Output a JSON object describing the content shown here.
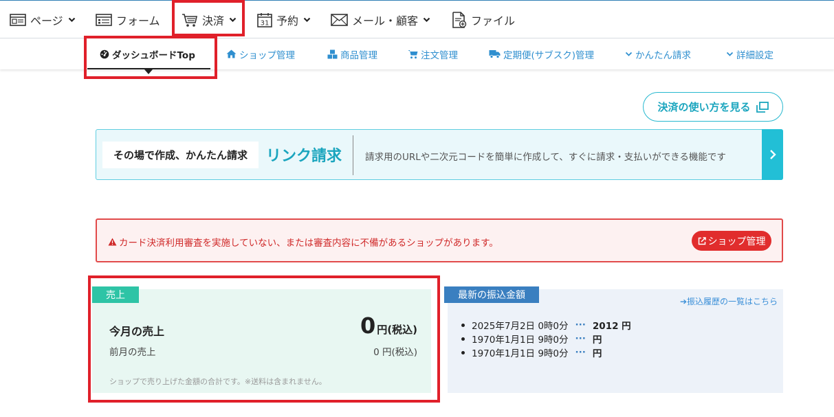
{
  "topnav": {
    "page": "ページ",
    "form": "フォーム",
    "payment": "決済",
    "reservation": "予約",
    "reservation_icon_text": "31",
    "mail": "メール・顧客",
    "file": "ファイル"
  },
  "subnav": {
    "dashboard": "ダッシュボードTop",
    "shop": "ショップ管理",
    "products": "商品管理",
    "orders": "注文管理",
    "subscription": "定期便(サブスク)管理",
    "easy_invoice": "かんたん請求",
    "settings": "詳細設定"
  },
  "howto_button": "決済の使い方を見る",
  "banner": {
    "tag": "その場で作成、かんたん請求",
    "title": "リンク請求",
    "description": "請求用のURLや二次元コードを簡単に作成して、すぐに請求・支払いができる機能です"
  },
  "alert": {
    "message": "カード決済利用審査を実施していない、または審査内容に不備があるショップがあります。",
    "button": "ショップ管理"
  },
  "sales": {
    "tag": "売上",
    "this_month_label": "今月の売上",
    "this_month_value": "0",
    "this_month_unit": "円(税込)",
    "last_month_label": "前月の売上",
    "last_month_value": "0 円(税込)",
    "note": "ショップで売り上げた金額の合計です。※送料は含まれません。"
  },
  "transfer": {
    "tag": "最新の振込金額",
    "history_link": "➔振込履歴の一覧はこちら",
    "entries": [
      {
        "date": "2025年7月2日 0時0分",
        "dots": "···",
        "amount": "2012 円"
      },
      {
        "date": "1970年1月1日 9時0分",
        "dots": "···",
        "amount": "円"
      },
      {
        "date": "1970年1月1日 9時0分",
        "dots": "···",
        "amount": "円"
      }
    ]
  },
  "colors": {
    "accent": "#1aa5be",
    "link": "#2f8fcf",
    "highlight": "#e0202a",
    "alert": "#d02a2a",
    "sales_tag": "#2ec4a6",
    "transfer_tag": "#3a7fc0"
  }
}
